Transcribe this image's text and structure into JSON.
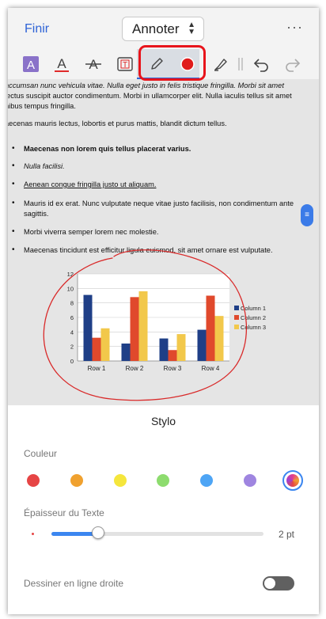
{
  "header": {
    "done_label": "Finir",
    "title": "Annoter",
    "more_label": "···"
  },
  "toolbar": {
    "tools": [
      "highlight-icon",
      "text-color-icon",
      "strikethrough-icon",
      "text-box-icon",
      "pencil-icon",
      "color-dot-icon",
      "highlighter-icon",
      "undo-icon",
      "redo-icon"
    ],
    "active_tool": "pencil-icon"
  },
  "document": {
    "lines": [
      "accumsan nunc vehicula vitae. Nulla eget justo in felis tristique fringilla. Morbi sit amet",
      "lectus suscipit auctor condimentum. Morbi in ullamcorper elit. Nulla iaculis tellus sit amet",
      "nibus tempus fringilla."
    ],
    "para2": "aecenas mauris lectus, lobortis et purus mattis, blandit dictum tellus.",
    "bullets": [
      "Maecenas non lorem quis tellus placerat varius.",
      "Nulla facilisi.",
      "Aenean congue fringilla justo ut aliquam.",
      "Mauris id ex erat. Nunc vulputate neque vitae justo facilisis, non condimentum ante",
      "sagittis.",
      "Morbi viverra semper lorem nec molestie.",
      "Maecenas tincidunt est efficitur ligula euismod, sit amet ornare est vulputate."
    ]
  },
  "chart_data": {
    "type": "bar",
    "categories": [
      "Row 1",
      "Row 2",
      "Row 3",
      "Row 4"
    ],
    "series": [
      {
        "name": "Column 1",
        "values": [
          9.1,
          2.4,
          3.1,
          4.3
        ],
        "color": "#1f3f87"
      },
      {
        "name": "Column 2",
        "values": [
          3.2,
          8.8,
          1.5,
          9.0
        ],
        "color": "#e0492c"
      },
      {
        "name": "Column 3",
        "values": [
          4.5,
          9.6,
          3.7,
          6.2
        ],
        "color": "#f2c84b"
      }
    ],
    "yticks": [
      "0",
      "2",
      "4",
      "6",
      "8",
      "10",
      "12"
    ],
    "ylim": [
      0,
      12
    ],
    "legend": "right",
    "grid": true
  },
  "annotation": {
    "stroke_color": "#d92a2a"
  },
  "sheet": {
    "title": "Stylo",
    "color_label": "Couleur",
    "colors": [
      "#e64545",
      "#f0a12f",
      "#f5e63c",
      "#8ddc6e",
      "#4ea5f5",
      "#9f85e0"
    ],
    "custom_color_icon": "color-wheel-icon",
    "thickness_label": "Épaisseur du Texte",
    "thickness_value": "2 pt",
    "thickness_fraction": 0.22,
    "straight_line_label": "Dessiner en ligne droite",
    "straight_line_on": false
  }
}
